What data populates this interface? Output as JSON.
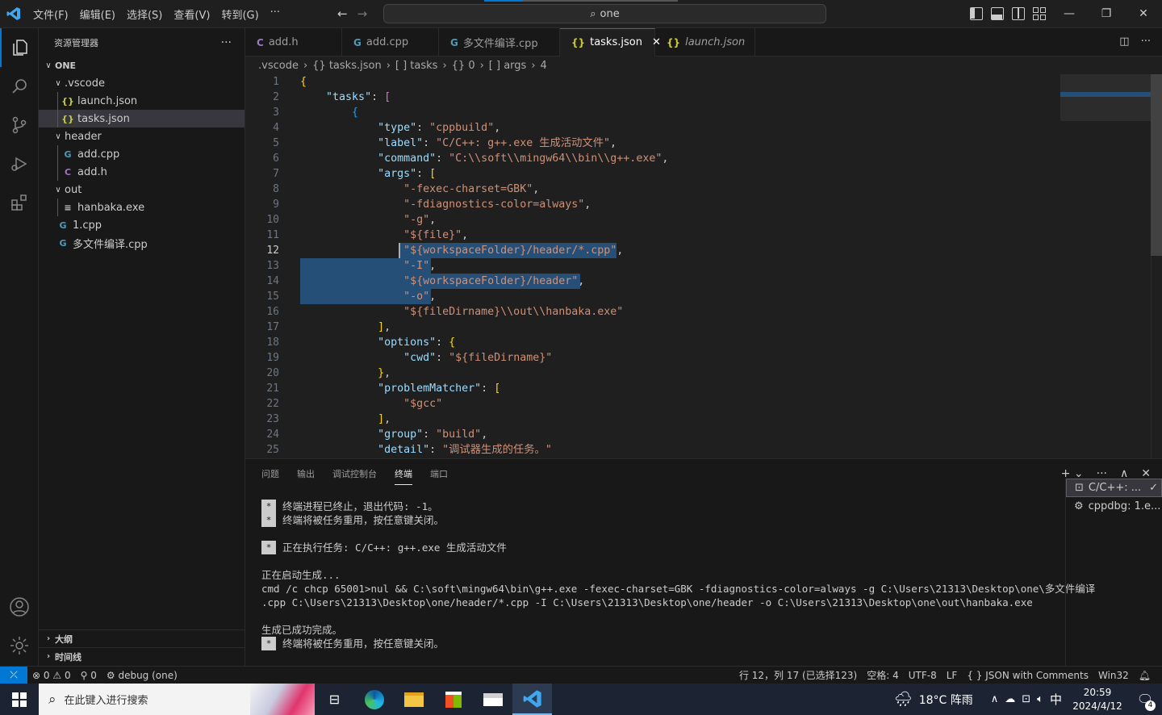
{
  "titlebar": {
    "menus": [
      "文件(F)",
      "编辑(E)",
      "选择(S)",
      "查看(V)",
      "转到(G)",
      "···"
    ],
    "search_text": "one"
  },
  "sidebar": {
    "title": "资源管理器",
    "more": "···",
    "root": "ONE",
    "items": [
      {
        "label": ".vscode",
        "type": "folder",
        "depth": 1
      },
      {
        "label": "launch.json",
        "type": "json",
        "depth": 2
      },
      {
        "label": "tasks.json",
        "type": "json",
        "depth": 2,
        "selected": true
      },
      {
        "label": "header",
        "type": "folder",
        "depth": 1
      },
      {
        "label": "add.cpp",
        "type": "cpp",
        "depth": 2
      },
      {
        "label": "add.h",
        "type": "c",
        "depth": 2
      },
      {
        "label": "out",
        "type": "folder",
        "depth": 1
      },
      {
        "label": "hanbaka.exe",
        "type": "exe",
        "depth": 2
      },
      {
        "label": "1.cpp",
        "type": "cpp",
        "depth": 1
      },
      {
        "label": "多文件编译.cpp",
        "type": "cpp",
        "depth": 1
      }
    ],
    "outline": "大纲",
    "timeline": "时间线"
  },
  "tabs": [
    {
      "label": "add.h",
      "icon": "C",
      "active": false,
      "italic": false
    },
    {
      "label": "add.cpp",
      "icon": "G",
      "active": false,
      "italic": false
    },
    {
      "label": "多文件编译.cpp",
      "icon": "G",
      "active": false,
      "italic": false
    },
    {
      "label": "tasks.json",
      "icon": "{}",
      "active": true,
      "italic": false
    },
    {
      "label": "launch.json",
      "icon": "{}",
      "active": false,
      "italic": true
    }
  ],
  "breadcrumb": [
    ".vscode",
    "{} tasks.json",
    "[ ] tasks",
    "{} 0",
    "[ ] args",
    "4"
  ],
  "code_lines": [
    "{",
    "    \"tasks\": [",
    "        {",
    "            \"type\": \"cppbuild\",",
    "            \"label\": \"C/C++: g++.exe 生成活动文件\",",
    "            \"command\": \"C:\\\\soft\\\\mingw64\\\\bin\\\\g++.exe\",",
    "            \"args\": [",
    "                \"-fexec-charset=GBK\",",
    "                \"-fdiagnostics-color=always\",",
    "                \"-g\",",
    "                \"${file}\",",
    "                \"${workspaceFolder}/header/*.cpp\",",
    "                \"-I\",",
    "                \"${workspaceFolder}/header\",",
    "                \"-o\",",
    "                \"${fileDirname}\\\\out\\\\hanbaka.exe\"",
    "            ],",
    "            \"options\": {",
    "                \"cwd\": \"${fileDirname}\"",
    "            },",
    "            \"problemMatcher\": [",
    "                \"$gcc\"",
    "            ],",
    "            \"group\": \"build\",",
    "            \"detail\": \"调试器生成的任务。\""
  ],
  "current_line": 12,
  "panel": {
    "tabs": [
      "问题",
      "输出",
      "调试控制台",
      "终端",
      "端口"
    ],
    "active_tab": "终端",
    "terminal_lines": [
      {
        "star": true,
        "text": "终端进程已终止，退出代码: -1。"
      },
      {
        "star": true,
        "text": "终端将被任务重用，按任意键关闭。"
      },
      {
        "star": false,
        "text": ""
      },
      {
        "star": true,
        "text": "正在执行任务: C/C++: g++.exe 生成活动文件"
      },
      {
        "star": false,
        "text": ""
      },
      {
        "star": false,
        "text": "正在启动生成..."
      },
      {
        "star": false,
        "text": "cmd /c chcp 65001>nul && C:\\soft\\mingw64\\bin\\g++.exe -fexec-charset=GBK -fdiagnostics-color=always -g C:\\Users\\21313\\Desktop\\one\\多文件编译"
      },
      {
        "star": false,
        "text": ".cpp C:\\Users\\21313\\Desktop\\one/header/*.cpp -I C:\\Users\\21313\\Desktop\\one/header -o C:\\Users\\21313\\Desktop\\one\\out\\hanbaka.exe"
      },
      {
        "star": false,
        "text": ""
      },
      {
        "star": false,
        "text": "生成已成功完成。"
      },
      {
        "star": true,
        "text": "终端将被任务重用，按任意键关闭。"
      }
    ],
    "terminals": [
      "C/C++: ...",
      "cppdbg: 1.e..."
    ]
  },
  "statusbar": {
    "errors": "0",
    "warnings": "0",
    "ports": "0",
    "debug": "debug (one)",
    "position": "行 12，列 17 (已选择123)",
    "spaces": "空格: 4",
    "encoding": "UTF-8",
    "eol": "LF",
    "language": "JSON with Comments",
    "platform": "Win32"
  },
  "taskbar": {
    "search_placeholder": "在此键入进行搜索",
    "weather": "18°C 阵雨",
    "ime": "中",
    "time": "20:59",
    "date": "2024/4/12",
    "notifications": "4"
  },
  "colors": {
    "accent": "#0078d4",
    "selection": "#264f78",
    "key": "#9cdcfe",
    "string": "#ce9178"
  }
}
